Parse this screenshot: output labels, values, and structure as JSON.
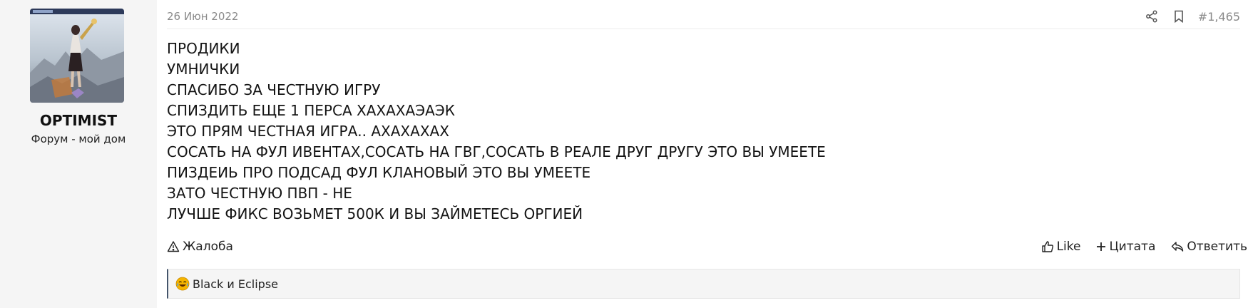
{
  "user": {
    "name": "OPTIMIST",
    "title": "Форум - мой дом"
  },
  "post": {
    "date": "26 Июн 2022",
    "number": "#1,465",
    "lines": [
      "ПРОДИКИ",
      "УМНИЧКИ",
      "СПАСИБО ЗА ЧЕСТНУЮ ИГРУ",
      "СПИЗДИТЬ ЕЩЕ 1 ПЕРСА ХАХАХАЭАЭК",
      "ЭТО ПРЯМ ЧЕСТНАЯ ИГРА.. АХАХАХАХ",
      "СОСАТЬ НА ФУЛ ИВЕНТАХ,СОСАТЬ НА ГВГ,СОСАТЬ В РЕАЛЕ ДРУГ ДРУГУ ЭТО ВЫ УМЕЕТЕ",
      "ПИЗДЕИЬ ПРО ПОДСАД ФУЛ КЛАНОВЫЙ ЭТО ВЫ УМЕЕТЕ",
      "ЗАТО ЧЕСТНУЮ ПВП - НЕ",
      "ЛУЧШЕ ФИКС ВОЗЬМЕТ 500К И ВЫ ЗАЙМЕТЕСЬ ОРГИЕЙ"
    ]
  },
  "footer": {
    "report_label": "Жалоба",
    "like_label": "Like",
    "quote_label": "Цитата",
    "reply_label": "Ответить"
  },
  "reactions": {
    "text": "Black и Eclipse",
    "icon": "laughing-emoji-icon"
  },
  "icons": {
    "share": "share-icon",
    "bookmark": "bookmark-icon",
    "report": "warning-icon",
    "like": "thumbs-up-icon",
    "quote": "plus-icon",
    "reply": "reply-icon"
  },
  "colors": {
    "sidebar_bg": "#f5f5f5",
    "muted_text": "#8a8a8a",
    "reaction_border": "#44546b",
    "emoji": "#f5b400"
  }
}
